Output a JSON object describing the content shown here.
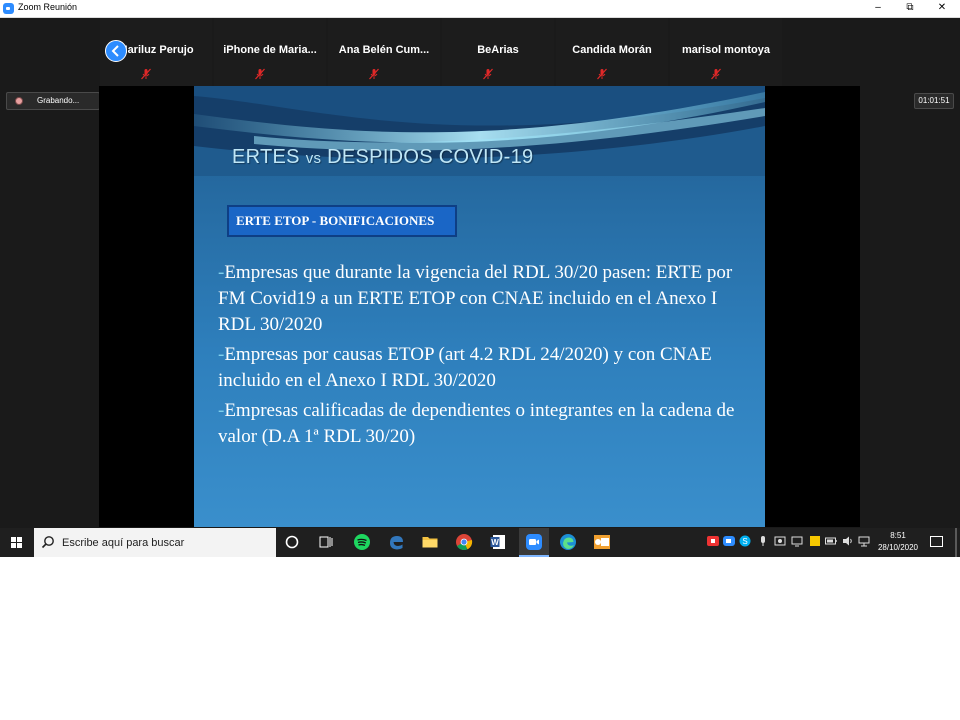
{
  "window": {
    "title": "Zoom Reunión",
    "minimize_glyph": "–",
    "restore_glyph": "⧉",
    "close_glyph": "✕"
  },
  "participants": [
    {
      "name": "Mariluz Perujo",
      "muted": true
    },
    {
      "name": "iPhone  de  Maria...",
      "muted": true
    },
    {
      "name": "Ana  Belén  Cum...",
      "muted": true
    },
    {
      "name": "BeArias",
      "muted": true
    },
    {
      "name": "Candida Morán",
      "muted": true
    },
    {
      "name": "marisol montoya",
      "muted": true
    }
  ],
  "recording": {
    "label": "Grabando..."
  },
  "timer": {
    "value": "01:01:51"
  },
  "slide": {
    "title_part1": "ERTES ",
    "title_vs": "vs",
    "title_part2": " DESPIDOS COVID-19",
    "badge": "ERTE ETOP - BONIFICACIONES",
    "bullets": [
      "Empresas que durante la vigencia del RDL 30/20 pasen: ERTE por FM Covid19 a un ERTE ETOP con CNAE incluido en el Anexo I RDL 30/2020",
      "Empresas por causas ETOP (art 4.2 RDL 24/2020) y con CNAE incluido en el Anexo I RDL 30/2020",
      "Empresas calificadas de dependientes o integrantes en la cadena de valor (D.A 1ª RDL 30/20)"
    ]
  },
  "taskbar": {
    "search_placeholder": "Escribe aquí para buscar",
    "pinned_icons": [
      "cortana-icon",
      "task-view-icon",
      "spotify-icon",
      "edge-legacy-icon",
      "file-explorer-icon",
      "chrome-icon",
      "word-icon",
      "zoom-icon",
      "edge-icon",
      "outlook-icon"
    ],
    "clock_time": "8:51",
    "clock_date": "28/10/2020"
  },
  "colors": {
    "zoom_blue": "#2d8cff",
    "slide_title": "#bfe6f6",
    "badge_bg": "#1a66c6"
  }
}
